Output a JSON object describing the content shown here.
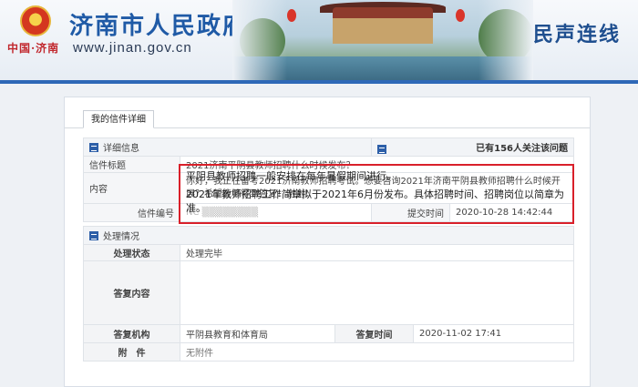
{
  "header": {
    "site_title": "济南市人民政府",
    "city_tag": "中国·济南",
    "url": "www.jinan.gov.cn",
    "section": "民声连线"
  },
  "panel": {
    "tab_label": "我的信件详细",
    "detail": {
      "heading": "详细信息",
      "followers": "已有156人关注该问题",
      "subject_label": "信件标题",
      "subject": "2021济南平阴县教师招聘什么时候发布？",
      "content_label": "内容",
      "content": "你好，我正在备考2021济南教师招聘考试。想要咨询2021年济南平阴县教师招聘什么时候开展？希望能够得到答复！谢谢！",
      "number_label": "信件编号",
      "number": "NC",
      "submit_label": "提交时间",
      "submit_time": "2020-10-28 14:42:44"
    },
    "process": {
      "heading": "处理情况",
      "status_label": "处理状态",
      "status": "处理完毕",
      "reply_label": "答复内容",
      "reply_line1": "平阴县教师招聘一般安排在每年暑假期间进行。",
      "reply_line2": "2021年教师招聘工作简章拟于2021年6月份发布。具体招聘时间、招聘岗位以简章为准。",
      "org_label": "答复机构",
      "org": "平阴县教育和体育局",
      "reply_time_label": "答复时间",
      "reply_time": "2020-11-02 17:41",
      "attach_label": "附　件",
      "attach": "无附件"
    }
  },
  "colors": {
    "accent": "#2e68b7",
    "highlight": "#d9202a"
  },
  "icons": [
    "national-emblem-icon",
    "section-square-icon"
  ]
}
